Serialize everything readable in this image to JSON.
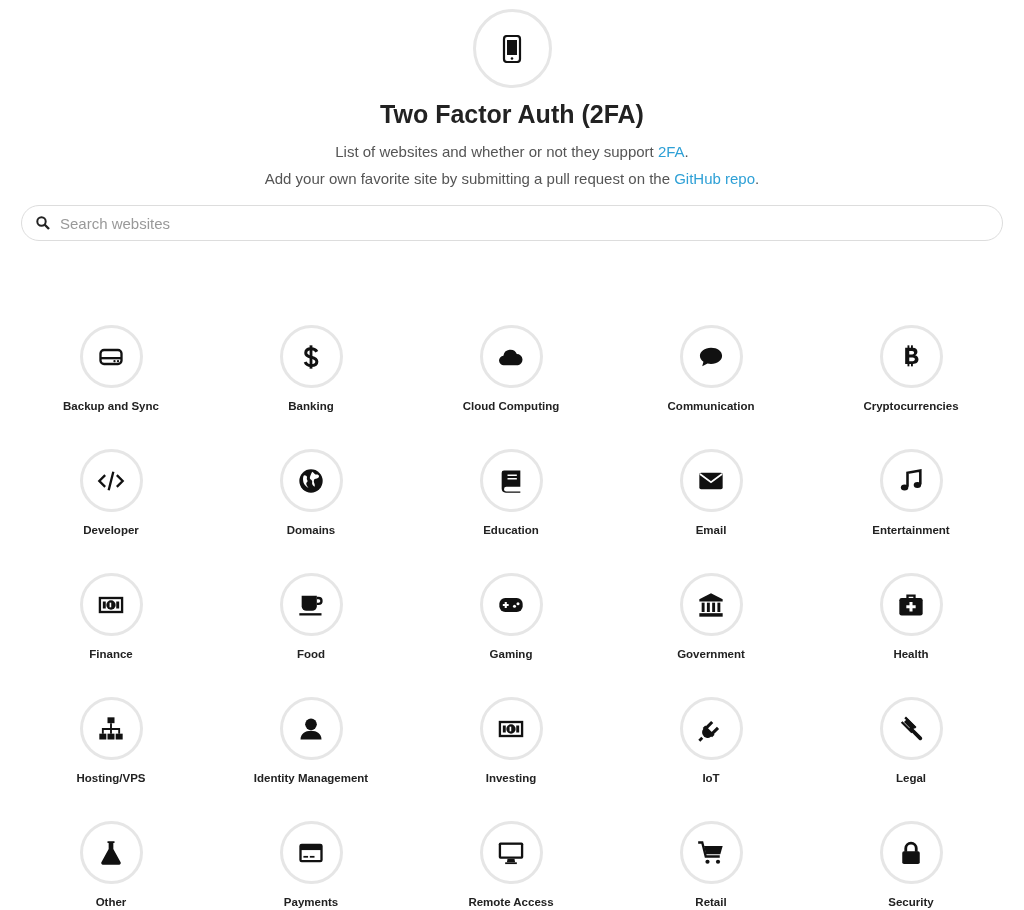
{
  "header": {
    "title": "Two Factor Auth (2FA)",
    "lines": [
      {
        "before": "List of websites and whether or not they support ",
        "link": "2FA",
        "after": "."
      },
      {
        "before": "Add your own favorite site by submitting a pull request on the ",
        "link": "GitHub repo",
        "after": "."
      }
    ]
  },
  "search": {
    "placeholder": "Search websites"
  },
  "categories": [
    {
      "label": "Backup and Sync"
    },
    {
      "label": "Banking"
    },
    {
      "label": "Cloud Computing"
    },
    {
      "label": "Communication"
    },
    {
      "label": "Cryptocurrencies"
    },
    {
      "label": "Developer"
    },
    {
      "label": "Domains"
    },
    {
      "label": "Education"
    },
    {
      "label": "Email"
    },
    {
      "label": "Entertainment"
    },
    {
      "label": "Finance"
    },
    {
      "label": "Food"
    },
    {
      "label": "Gaming"
    },
    {
      "label": "Government"
    },
    {
      "label": "Health"
    },
    {
      "label": "Hosting/VPS"
    },
    {
      "label": "Identity Management"
    },
    {
      "label": "Investing"
    },
    {
      "label": "IoT"
    },
    {
      "label": "Legal"
    },
    {
      "label": "Other"
    },
    {
      "label": "Payments"
    },
    {
      "label": "Remote Access"
    },
    {
      "label": "Retail"
    },
    {
      "label": "Security"
    }
  ]
}
